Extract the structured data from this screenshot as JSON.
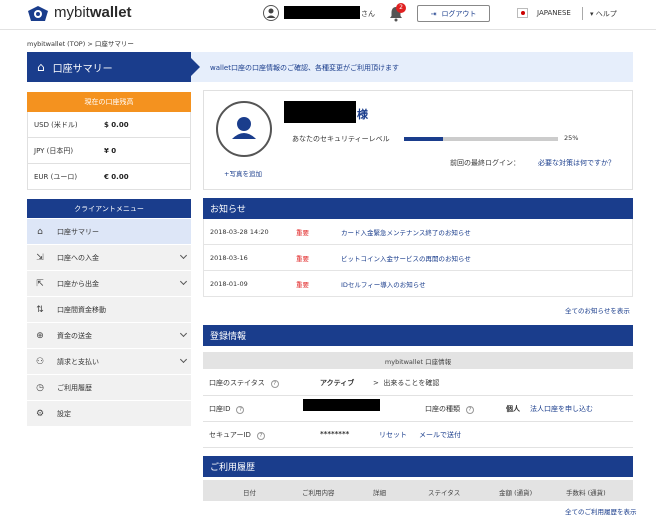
{
  "header": {
    "logo_prefix": "mybit",
    "logo_suffix": "wallet",
    "user_suffix": "さん",
    "notification_count": "2",
    "logout_label": "ログアウト",
    "language": "JAPANESE",
    "help_label": "ヘルプ"
  },
  "breadcrumb": "mybitwallet (TOP)  >  口座サマリー",
  "title": "口座サマリー",
  "title_message": "wallet口座の口座情報のご確認、各種変更がご利用頂けます",
  "balance": {
    "heading": "現在の口座残高",
    "rows": [
      {
        "currency": "USD (米ドル)",
        "amount": "$ 0.00"
      },
      {
        "currency": "JPY (日本円)",
        "amount": "¥ 0"
      },
      {
        "currency": "EUR (ユーロ)",
        "amount": "€ 0.00"
      }
    ]
  },
  "menu": {
    "heading": "クライアントメニュー",
    "items": [
      {
        "label": "口座サマリー",
        "icon": "bank-icon",
        "glyph": "⌂"
      },
      {
        "label": "口座への入金",
        "icon": "deposit-icon",
        "glyph": "⇲"
      },
      {
        "label": "口座から出金",
        "icon": "withdraw-icon",
        "glyph": "⇱"
      },
      {
        "label": "口座間資金移動",
        "icon": "transfer-icon",
        "glyph": "⇅"
      },
      {
        "label": "資金の送金",
        "icon": "send-money-icon",
        "glyph": "⊕"
      },
      {
        "label": "請求と支払い",
        "icon": "billing-icon",
        "glyph": "⚇"
      },
      {
        "label": "ご利用履歴",
        "icon": "history-icon",
        "glyph": "◷"
      },
      {
        "label": "設定",
        "icon": "gear-icon",
        "glyph": "⚙"
      }
    ]
  },
  "profile": {
    "name_suffix": "様",
    "photo_link": "+写真を追加",
    "security_label": "あなたのセキュリティーレベル",
    "security_level": 25,
    "security_pct": "25%",
    "last_login_label": "前回の最終ログイン：",
    "todo_link": "必要な対策は何ですか？"
  },
  "news": {
    "heading": "お知らせ",
    "items": [
      {
        "date": "2018-03-28 14:20",
        "badge": "重要",
        "title": "カード入金緊急メンテナンス終了のお知らせ"
      },
      {
        "date": "2018-03-16",
        "badge": "重要",
        "title": "ビットコイン入金サービスの再開のお知らせ"
      },
      {
        "date": "2018-01-09",
        "badge": "重要",
        "title": "IDセルフィー導入のお知らせ"
      }
    ],
    "all_link": "全てのお知らせを表示"
  },
  "registration": {
    "heading": "登録情報",
    "subheading": "mybitwallet 口座情報",
    "status_label": "口座のステイタス",
    "status_value": "アクティブ",
    "status_link": "出来ることを確認",
    "account_id_label": "口座ID",
    "account_type_label": "口座の種類",
    "account_type_value": "個人",
    "account_type_link": "法人口座を申し込む",
    "secure_id_label": "セキュアーID",
    "secure_id_value": "********",
    "reset_link": "リセット",
    "email_link": "メールで送付"
  },
  "history": {
    "heading": "ご利用履歴",
    "columns": [
      "日付",
      "ご利用内容",
      "詳細",
      "ステイタス",
      "金額 (通貨)",
      "手数料 (通貨)"
    ],
    "all_link": "全てのご利用履歴を表示"
  },
  "colors": {
    "primary": "#1a3d8c",
    "accent": "#f4921f",
    "alert": "#e02020",
    "title_bar_bg": "#e6eefb"
  }
}
